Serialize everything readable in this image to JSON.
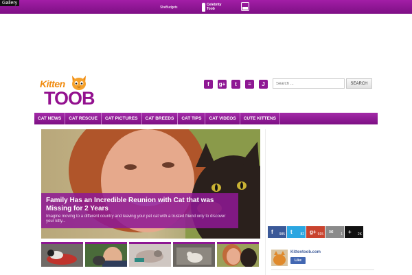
{
  "topbar": {
    "gallery": "Gallery",
    "network": [
      {
        "name": "SheBudgets"
      },
      {
        "name_line1": "Celebrity",
        "name_line2": "Toob"
      },
      {
        "name": "tiny-tv-icon"
      }
    ]
  },
  "header": {
    "logo_kitten": "Kitten",
    "logo_toob": "TOOB",
    "social_icons": [
      "facebook-icon",
      "google-plus-icon",
      "twitter-icon",
      "rss-icon",
      "stumbleupon-icon"
    ],
    "social_glyphs": [
      "f",
      "g+",
      "t",
      "≡",
      "J"
    ],
    "search_placeholder": "Search ...",
    "search_button": "SEARCH"
  },
  "nav": [
    "CAT NEWS",
    "CAT RESCUE",
    "CAT PICTURES",
    "CAT BREEDS",
    "CAT TIPS",
    "CAT VIDEOS",
    "CUTE KITTENS"
  ],
  "hero": {
    "title": "Family Has an Incredible Reunion with Cat that was Missing for 2 Years",
    "description": "Imagine moving to a different country and leaving your pet cat with a trusted friend only to discover your kitty..."
  },
  "share": [
    {
      "icon": "f",
      "count": "985",
      "color": "#3b5998"
    },
    {
      "icon": "t",
      "count": "82",
      "color": "#2ba6e1"
    },
    {
      "icon": "g+",
      "count": "915",
      "color": "#c9432e"
    },
    {
      "icon": "✉",
      "count": "1",
      "color": "#8a8a8a"
    },
    {
      "icon": "+",
      "count": "2K",
      "color": "#111111"
    }
  ],
  "sidebar": {
    "fb_name": "Kittentoob.com",
    "fb_like": "Like"
  },
  "colors": {
    "brand_purple": "#8e1793",
    "brand_orange": "#f08a0c"
  }
}
